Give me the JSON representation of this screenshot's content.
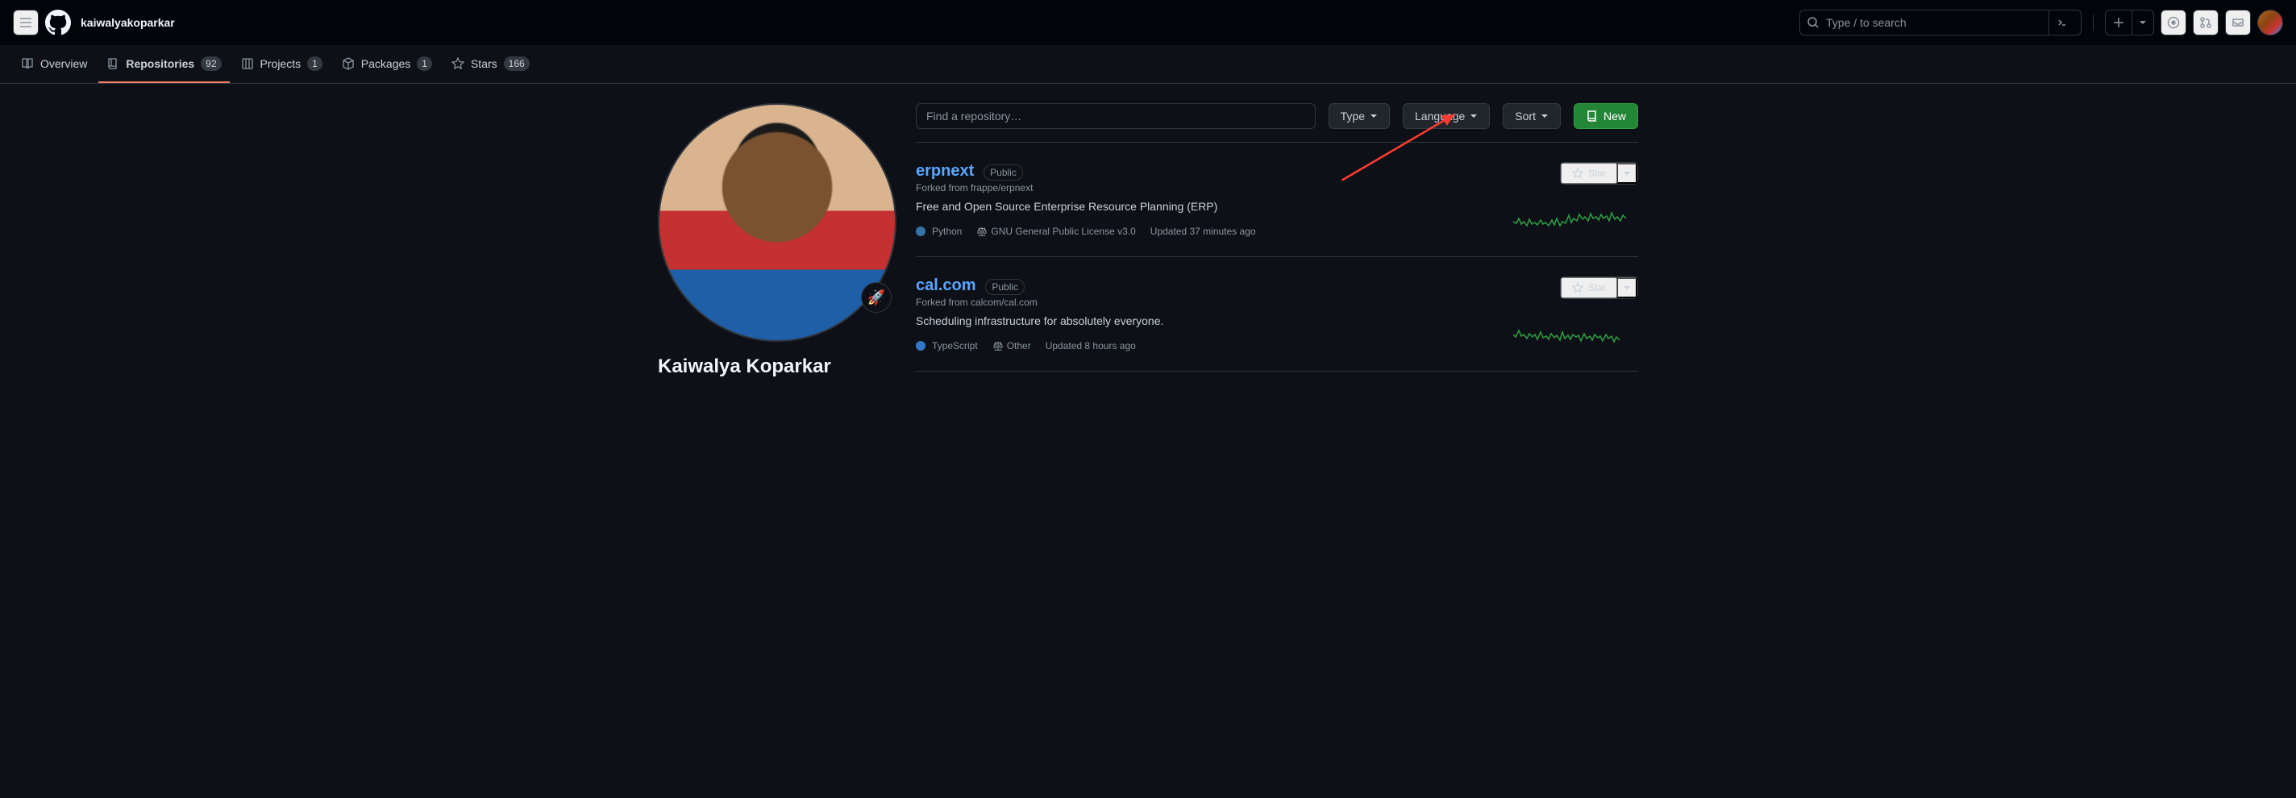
{
  "header": {
    "username": "kaiwalyakoparkar",
    "search_placeholder": "Type / to search"
  },
  "tabs": {
    "overview": "Overview",
    "repositories": "Repositories",
    "repositories_count": "92",
    "projects": "Projects",
    "projects_count": "1",
    "packages": "Packages",
    "packages_count": "1",
    "stars": "Stars",
    "stars_count": "166"
  },
  "profile": {
    "fullname": "Kaiwalya Koparkar",
    "status_emoji": "🚀"
  },
  "filters": {
    "find_placeholder": "Find a repository…",
    "type": "Type",
    "language": "Language",
    "sort": "Sort",
    "new": "New"
  },
  "repos": [
    {
      "name": "erpnext",
      "visibility": "Public",
      "forked_from": "Forked from frappe/erpnext",
      "description": "Free and Open Source Enterprise Resource Planning (ERP)",
      "language": "Python",
      "language_color": "#3572A5",
      "license": "GNU General Public License v3.0",
      "updated": "Updated 37 minutes ago",
      "star_label": "Star"
    },
    {
      "name": "cal.com",
      "visibility": "Public",
      "forked_from": "Forked from calcom/cal.com",
      "description": "Scheduling infrastructure for absolutely everyone.",
      "language": "TypeScript",
      "language_color": "#3178c6",
      "license": "Other",
      "updated": "Updated 8 hours ago",
      "star_label": "Star"
    }
  ]
}
